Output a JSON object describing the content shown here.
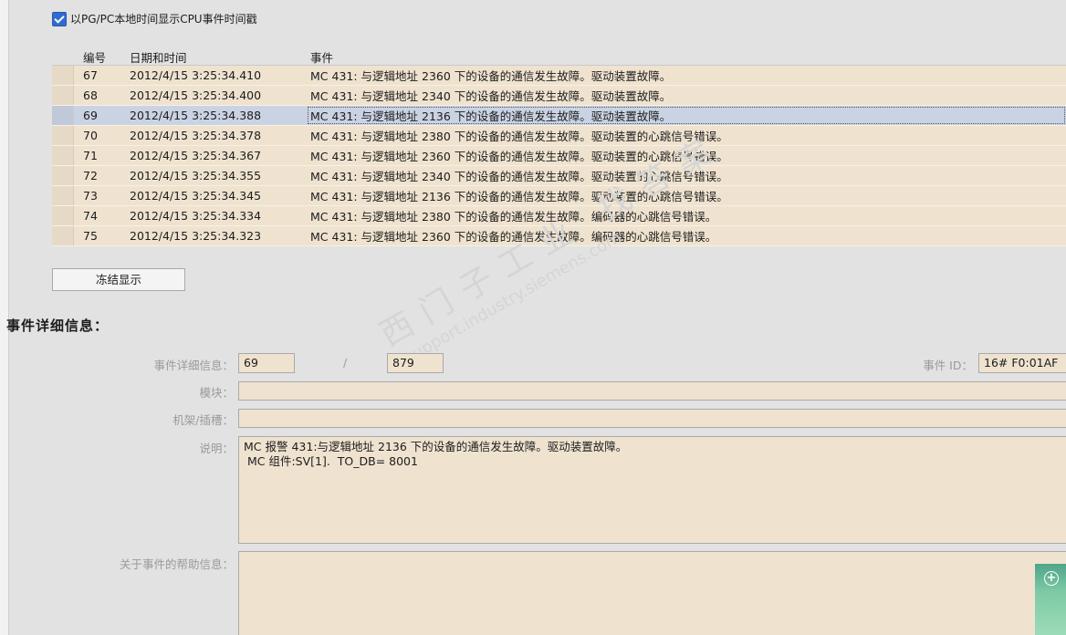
{
  "options": {
    "show_local_time_label": "以PG/PC本地时间显示CPU事件时间戳",
    "show_local_time_checked": true
  },
  "table": {
    "headers": [
      "编号",
      "日期和时间",
      "事件"
    ],
    "rows": [
      {
        "no": "67",
        "datetime": "2012/4/15 3:25:34.410",
        "event": "MC 431: 与逻辑地址 2360 下的设备的通信发生故障。驱动装置故障。"
      },
      {
        "no": "68",
        "datetime": "2012/4/15 3:25:34.400",
        "event": "MC 431: 与逻辑地址 2340 下的设备的通信发生故障。驱动装置故障。"
      },
      {
        "no": "69",
        "datetime": "2012/4/15 3:25:34.388",
        "event": "MC 431: 与逻辑地址 2136 下的设备的通信发生故障。驱动装置故障。"
      },
      {
        "no": "70",
        "datetime": "2012/4/15 3:25:34.378",
        "event": "MC 431: 与逻辑地址 2380 下的设备的通信发生故障。驱动装置的心跳信号错误。"
      },
      {
        "no": "71",
        "datetime": "2012/4/15 3:25:34.367",
        "event": "MC 431: 与逻辑地址 2360 下的设备的通信发生故障。驱动装置的心跳信号错误。"
      },
      {
        "no": "72",
        "datetime": "2012/4/15 3:25:34.355",
        "event": "MC 431: 与逻辑地址 2340 下的设备的通信发生故障。驱动装置的心跳信号错误。"
      },
      {
        "no": "73",
        "datetime": "2012/4/15 3:25:34.345",
        "event": "MC 431: 与逻辑地址 2136 下的设备的通信发生故障。驱动装置的心跳信号错误。"
      },
      {
        "no": "74",
        "datetime": "2012/4/15 3:25:34.334",
        "event": "MC 431: 与逻辑地址 2380 下的设备的通信发生故障。编码器的心跳信号错误。"
      },
      {
        "no": "75",
        "datetime": "2012/4/15 3:25:34.323",
        "event": "MC 431: 与逻辑地址 2360 下的设备的通信发生故障。编码器的心跳信号错误。"
      }
    ]
  },
  "freeze_button_label": "冻结显示",
  "details": {
    "title": "事件详细信息：",
    "event_details_label": "事件详细信息：",
    "event_index": "69",
    "separator": "/",
    "event_total": "879",
    "event_id_label": "事件 ID：",
    "event_id": "16# F0:01AF",
    "module_label": "模块：",
    "module_value": "",
    "rack_slot_label": "机架/插槽：",
    "rack_slot_value": "",
    "description_label": "说明：",
    "description": "MC 报警 431:与逻辑地址 2136 下的设备的通信发生故障。驱动装置故障。\n MC 组件:SV[1].  TO_DB= 8001",
    "help_label": "关于事件的帮助信息：",
    "help_value": ""
  },
  "watermark": {
    "line1": "西门子工业 找答案",
    "line2": "support.industry.siemens.com"
  },
  "side_button_icon": "plus-circle-icon"
}
